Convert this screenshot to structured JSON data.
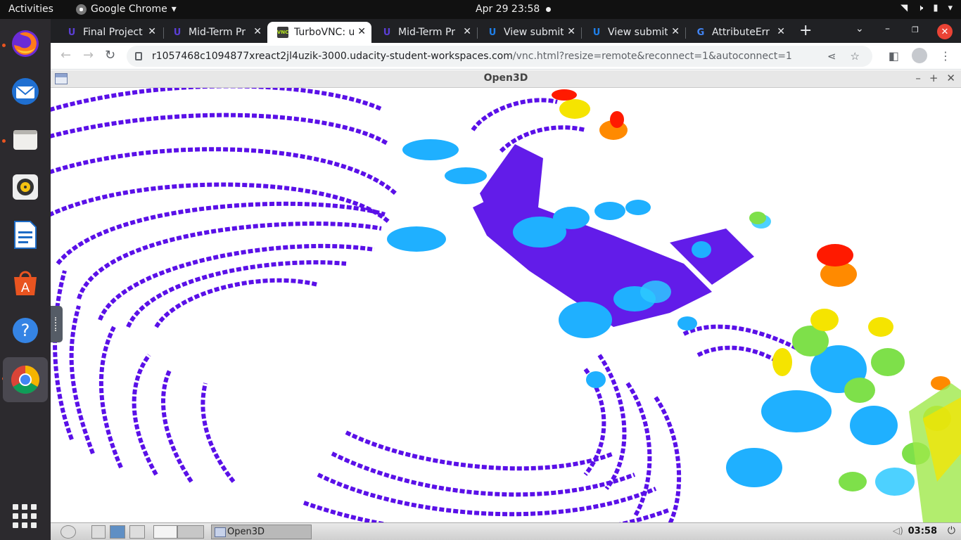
{
  "topbar": {
    "activities": "Activities",
    "app_name": "Google Chrome",
    "clock": "Apr 29  23:58"
  },
  "dock": {
    "apps": [
      "firefox",
      "thunderbird",
      "files",
      "rhythmbox",
      "libreoffice-writer",
      "ubuntu-software",
      "help",
      "google-chrome"
    ],
    "running": [
      "firefox",
      "files",
      "google-chrome"
    ],
    "active": "google-chrome"
  },
  "tabs": [
    {
      "title": "Final Project",
      "favicon": "udacity-icon"
    },
    {
      "title": "Mid-Term Pr",
      "favicon": "udacity-icon"
    },
    {
      "title": "TurboVNC: u",
      "favicon": "vnc-icon",
      "active": true
    },
    {
      "title": "Mid-Term Pr",
      "favicon": "udacity-icon"
    },
    {
      "title": "View submit",
      "favicon": "udacity-u-icon"
    },
    {
      "title": "View submit",
      "favicon": "udacity-u-icon"
    },
    {
      "title": "AttributeErr",
      "favicon": "google-icon"
    }
  ],
  "omnibox": {
    "host": "r1057468c1094877xreact2jl4uzik-3000.udacity-student-workspaces.com",
    "path": "/vnc.html?resize=remote&reconnect=1&autoconnect=1"
  },
  "o3d_window": {
    "title": "Open3D"
  },
  "vnc_taskbar": {
    "task_label": "Open3D",
    "time": "03:58"
  },
  "colors": {
    "accent": "#e95420",
    "pointcloud_low": "#5a10e8",
    "pointcloud_mid": "#1fb0ff",
    "pointcloud_high": "#ff1a00"
  }
}
